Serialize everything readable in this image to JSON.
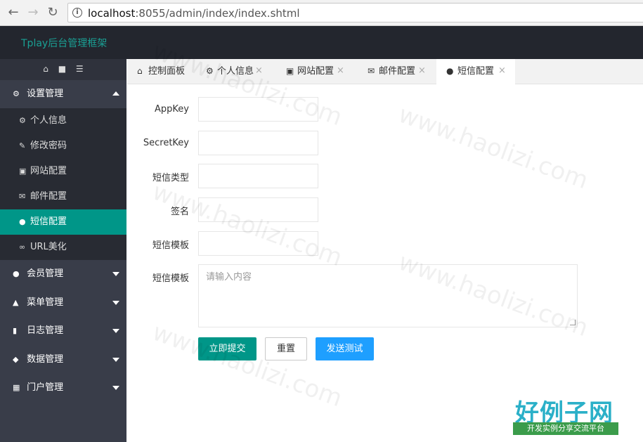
{
  "browser": {
    "url_host": "localhost",
    "url_path": ":8055/admin/index/index.shtml"
  },
  "header": {
    "brand": "Tplay后台管理框架"
  },
  "sidebar": {
    "tools": [
      "home-icon",
      "trash-icon",
      "menu-icon"
    ],
    "groups": [
      {
        "label": "设置管理",
        "icon": "gears-icon"
      },
      {
        "label": "会员管理",
        "icon": "user-icon"
      },
      {
        "label": "菜单管理",
        "icon": "sitemap-icon"
      },
      {
        "label": "日志管理",
        "icon": "book-icon"
      },
      {
        "label": "数据管理",
        "icon": "cubes-icon"
      },
      {
        "label": "门户管理",
        "icon": "grid-icon"
      }
    ],
    "items": [
      {
        "label": "个人信息",
        "icon": "gear-icon"
      },
      {
        "label": "修改密码",
        "icon": "edit-icon"
      },
      {
        "label": "网站配置",
        "icon": "desktop-icon"
      },
      {
        "label": "邮件配置",
        "icon": "envelope-icon"
      },
      {
        "label": "短信配置",
        "icon": "comment-icon"
      },
      {
        "label": "URL美化",
        "icon": "link-icon"
      }
    ]
  },
  "tabs": [
    {
      "label": "控制面板",
      "icon": "home-icon"
    },
    {
      "label": "个人信息",
      "icon": "gear-icon"
    },
    {
      "label": "网站配置",
      "icon": "desktop-icon"
    },
    {
      "label": "邮件配置",
      "icon": "envelope-icon"
    },
    {
      "label": "短信配置",
      "icon": "comment-icon"
    }
  ],
  "form": {
    "appkey_label": "AppKey",
    "secretkey_label": "SecretKey",
    "type_label": "短信类型",
    "sign_label": "签名",
    "template_label": "短信模板",
    "template2_label": "短信模板",
    "textarea_placeholder": "请输入内容",
    "submit_label": "立即提交",
    "reset_label": "重置",
    "test_label": "发送测试"
  },
  "watermark": {
    "text": "www.haolizi.com",
    "logo_big": "好例子网",
    "logo_small": "开发实例分享交流平台"
  },
  "colors": {
    "accent": "#009688",
    "header_bg": "#23262e",
    "sidebar_bg": "#393d49",
    "test_button": "#1e9fff"
  }
}
